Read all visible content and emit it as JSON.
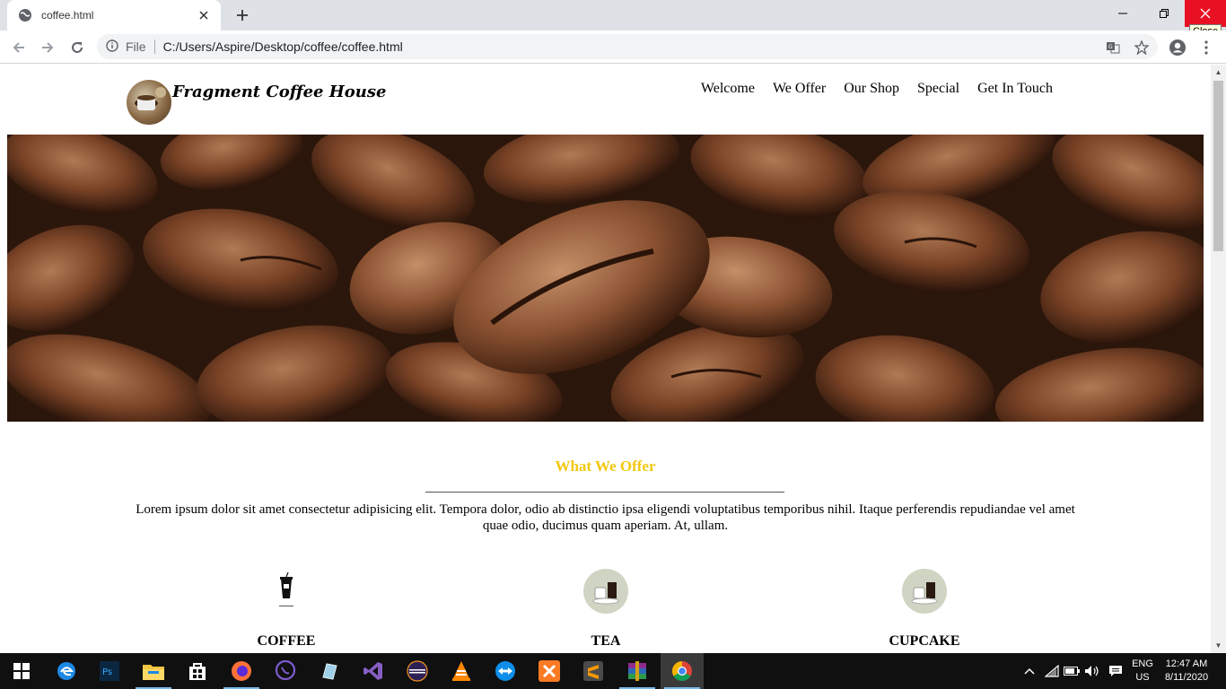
{
  "browser": {
    "tab_title": "coffee.html",
    "scheme_label": "File",
    "url": "C:/Users/Aspire/Desktop/coffee/coffee.html",
    "close_tooltip": "Close"
  },
  "site": {
    "brand": "Fragment Coffee House",
    "nav": [
      "Welcome",
      "We Offer",
      "Our Shop",
      "Special",
      "Get In Touch"
    ],
    "section_title": "What We Offer",
    "section_text": "Lorem ipsum dolor sit amet consectetur adipisicing elit. Tempora dolor, odio ab distinctio ipsa eligendi voluptatibus temporibus nihil. Itaque perferendis repudiandae vel amet quae odio, ducimus quam aperiam. At, ullam.",
    "cards": [
      {
        "title": "COFFEE",
        "icon": "iced-coffee-icon"
      },
      {
        "title": "TEA",
        "icon": "coffee-cups-icon"
      },
      {
        "title": "CUPCAKE",
        "icon": "coffee-cups-icon"
      }
    ],
    "accent_color": "#f2c811"
  },
  "taskbar": {
    "apps": [
      "start",
      "edge",
      "photoshop",
      "file-explorer",
      "store",
      "firefox",
      "viber",
      "notepad",
      "visual-studio",
      "eclipse",
      "vlc",
      "teamviewer",
      "xampp",
      "sublime",
      "winrar",
      "chrome"
    ],
    "lang_line1": "ENG",
    "lang_line2": "US",
    "time": "12:47 AM",
    "date": "8/11/2020"
  }
}
